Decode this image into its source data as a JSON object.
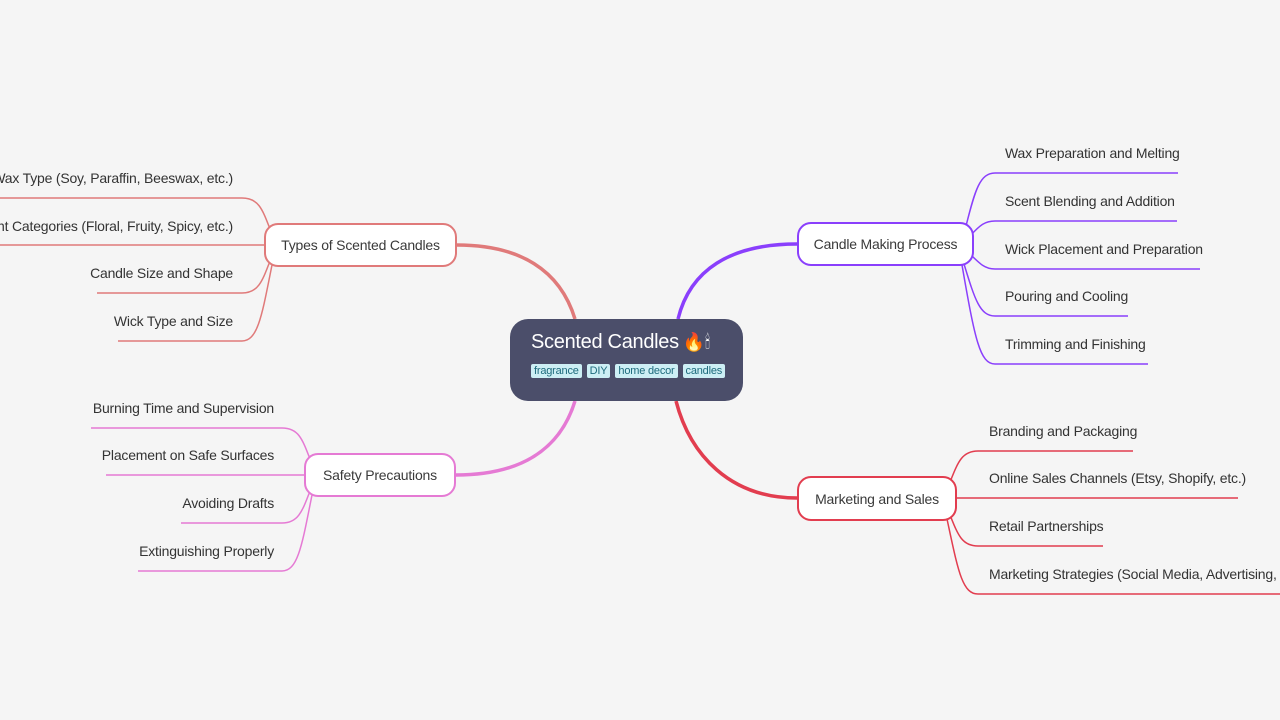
{
  "root": {
    "title": "Scented Candles",
    "emoji": "🔥🕯",
    "tags": [
      "fragrance",
      "DIY",
      "home decor",
      "candles"
    ]
  },
  "colors": {
    "background": "#f5f5f5",
    "root_fill": "#4b4e6a",
    "tag_fill": "#cdeff5",
    "tag_text": "#1e6b7d",
    "types": "#e07a7a",
    "making": "#8a3ffc",
    "safety": "#e57ad4",
    "marketing": "#e23d4f"
  },
  "branches": {
    "types": {
      "label": "Types of Scented Candles",
      "children": [
        "Wax Type (Soy, Paraffin, Beeswax, etc.)",
        "Scent Categories (Floral, Fruity, Spicy, etc.)",
        "Candle Size and Shape",
        "Wick Type and Size"
      ]
    },
    "safety": {
      "label": "Safety Precautions",
      "children": [
        "Burning Time and Supervision",
        "Placement on Safe Surfaces",
        "Avoiding Drafts",
        "Extinguishing Properly"
      ]
    },
    "making": {
      "label": "Candle Making Process",
      "children": [
        "Wax Preparation and Melting",
        "Scent Blending and Addition",
        "Wick Placement and Preparation",
        "Pouring and Cooling",
        "Trimming and Finishing"
      ]
    },
    "marketing": {
      "label": "Marketing and Sales",
      "children": [
        "Branding and Packaging",
        "Online Sales Channels (Etsy, Shopify, etc.)",
        "Retail Partnerships",
        "Marketing Strategies (Social Media, Advertising, etc.)"
      ]
    }
  }
}
